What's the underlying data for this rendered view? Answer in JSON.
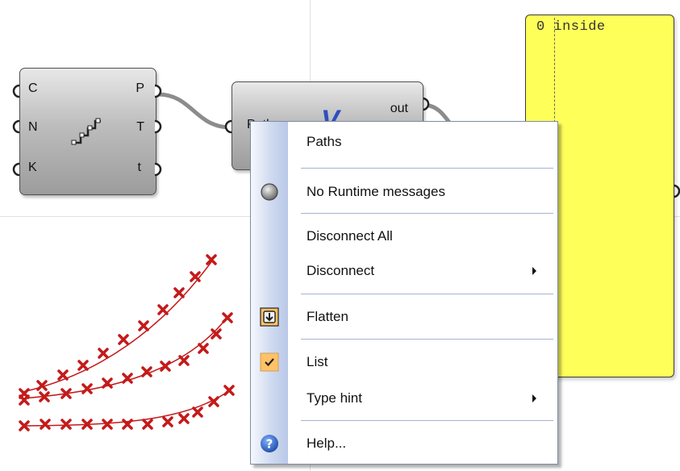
{
  "panel": {
    "text": "0 inside"
  },
  "components": {
    "series": {
      "inputs": [
        "C",
        "N",
        "K"
      ],
      "outputs": [
        "P",
        "T",
        "t"
      ]
    },
    "param": {
      "output": "out",
      "input_partial": "Path"
    }
  },
  "context_menu": {
    "name_field": "Paths",
    "runtime_messages": "No Runtime messages",
    "disconnect_all": "Disconnect All",
    "disconnect": "Disconnect",
    "flatten": "Flatten",
    "list": "List",
    "type_hint": "Type hint",
    "help": "Help..."
  },
  "colors": {
    "canvas": "#ffffff",
    "grid": "#e4e2d8",
    "panel": "#ffff5a",
    "points": "#c41a1a",
    "checked_icon_bg": "#ffc266",
    "help_icon": "#2c5fb8"
  }
}
